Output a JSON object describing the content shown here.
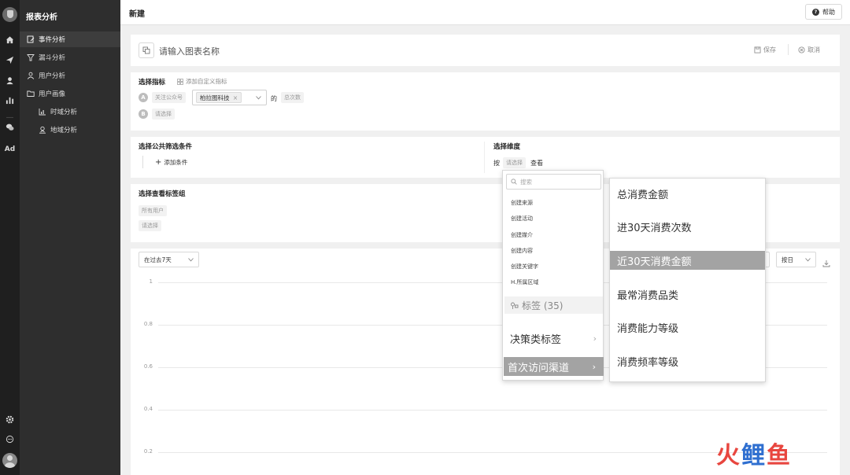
{
  "menu": {
    "title": "报表分析",
    "items": [
      {
        "label": "事件分析",
        "active": true
      },
      {
        "label": "漏斗分析"
      },
      {
        "label": "用户分析"
      },
      {
        "label": "用户画像"
      },
      {
        "label": "时域分析"
      },
      {
        "label": "地域分析"
      }
    ]
  },
  "rail": {
    "ad_label": "Ad"
  },
  "header": {
    "title": "新建",
    "help_label": "帮助"
  },
  "name_card": {
    "placeholder": "请输入图表名称",
    "save_label": "保存",
    "cancel_label": "取消"
  },
  "metric": {
    "title": "选择指标",
    "add_custom": "添加自定义指标",
    "row_a": {
      "badge": "A",
      "event": "关注公众号",
      "tag": "柏拉图科技",
      "tag_close": "×",
      "connector": "的",
      "measure": "总次数"
    },
    "row_b": {
      "badge": "B",
      "placeholder": "请选择"
    }
  },
  "filter": {
    "title": "选择公共筛选条件",
    "add_condition": "添加条件"
  },
  "dimension": {
    "title": "选择维度",
    "prefix": "按",
    "select": "请选择",
    "suffix": "查看"
  },
  "label_group": {
    "title": "选择查看标签组",
    "all_users": "所有用户",
    "placeholder": "请选择"
  },
  "chart": {
    "range_select": "在过去7天",
    "granularity": "按日",
    "y_ticks": [
      "1",
      "0.8",
      "0.6",
      "0.4",
      "0.2"
    ]
  },
  "dropdown_dimension": {
    "search_placeholder": "搜索",
    "options": [
      "创建来源",
      "创建活动",
      "创建媒介",
      "创建内容",
      "创建关键字",
      "H.所属区域"
    ],
    "group_label": "标签 (35)",
    "categories": [
      {
        "label": "决策类标签",
        "highlight": false
      },
      {
        "label": "首次访问渠道",
        "highlight": true
      }
    ]
  },
  "dropdown_tags": {
    "options": [
      {
        "label": "总消费金额",
        "highlight": false
      },
      {
        "label": "进30天消费次数",
        "highlight": false
      },
      {
        "label": "近30天消费金额",
        "highlight": true
      },
      {
        "label": "最常消费品类",
        "highlight": false
      },
      {
        "label": "消费能力等级",
        "highlight": false
      },
      {
        "label": "消费频率等级",
        "highlight": false
      }
    ]
  },
  "watermark": {
    "chars": [
      "火",
      "鲤",
      "鱼"
    ]
  },
  "colors": {
    "watermark_1": "#e8463f",
    "watermark_2": "#2f6fd0",
    "watermark_3": "#e8463f",
    "highlight": "#a3a3a3"
  }
}
